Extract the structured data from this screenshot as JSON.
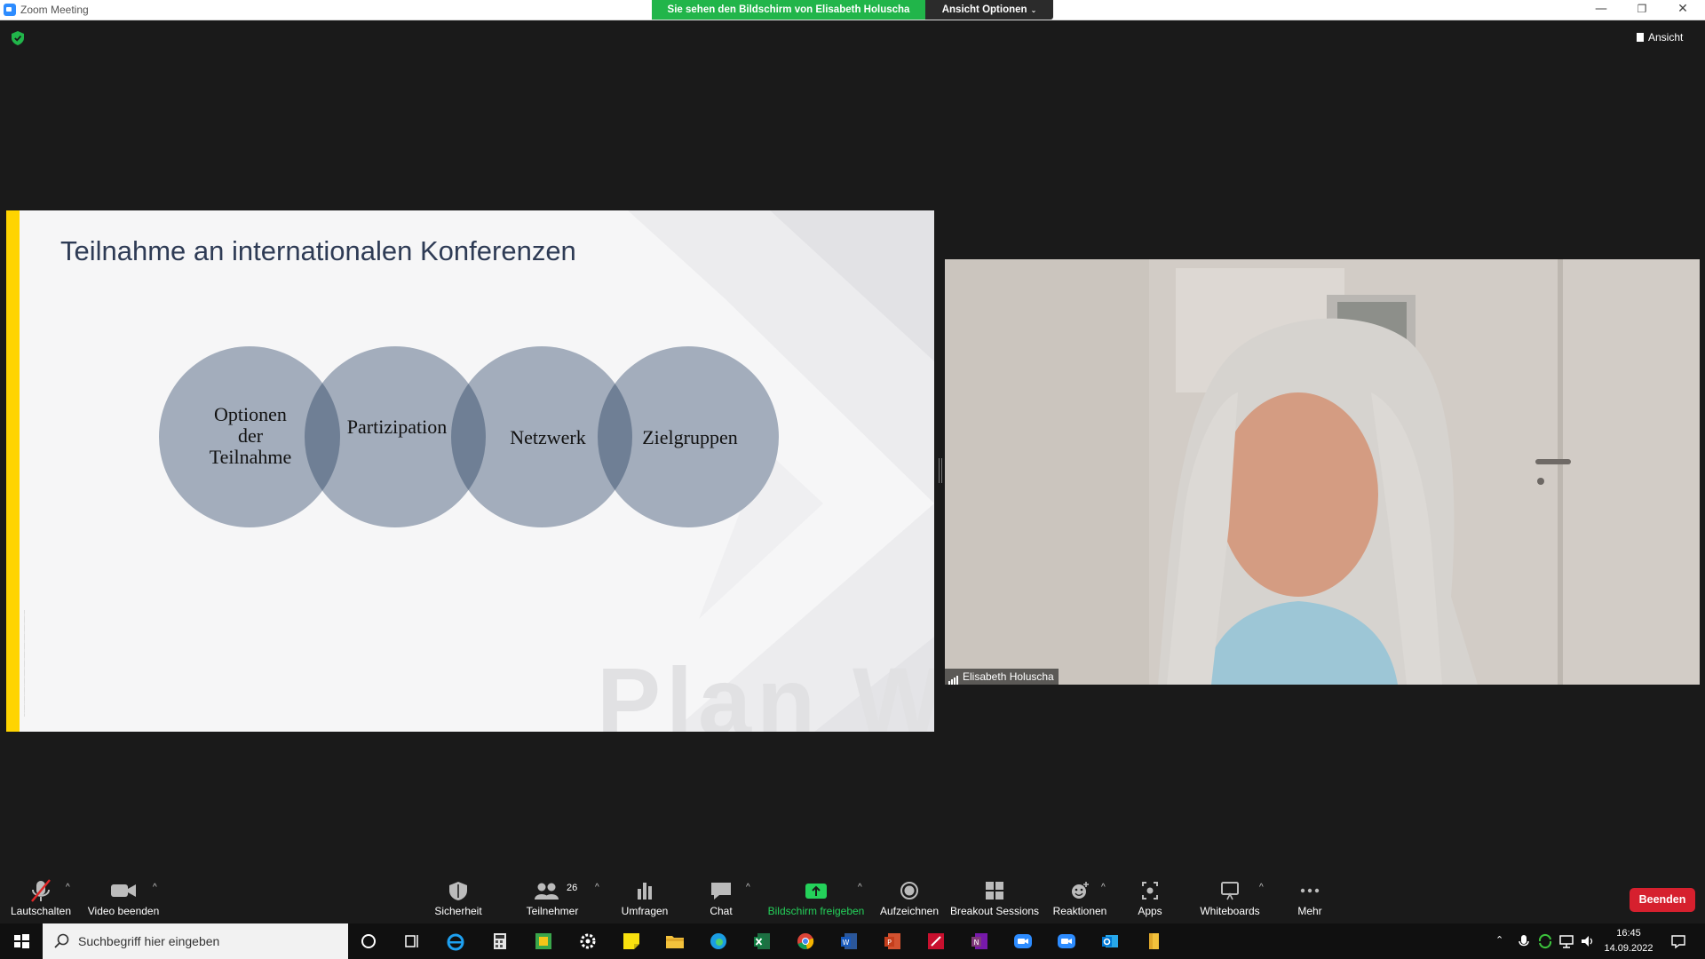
{
  "window": {
    "title": "Zoom Meeting",
    "minimize_glyph": "—",
    "restore_glyph": "❐",
    "close_glyph": "✕"
  },
  "banner": {
    "sharing_text": "Sie sehen den Bildschirm von Elisabeth Holuscha",
    "view_options_label": "Ansicht Optionen",
    "view_options_caret": "⌄"
  },
  "view_button": {
    "label": "Ansicht"
  },
  "slide": {
    "title": "Teilnahme an internationalen Konferenzen",
    "circles": [
      {
        "label": "Optionen der Teilnahme"
      },
      {
        "label": "Partizipation"
      },
      {
        "label": "Netzwerk"
      },
      {
        "label": "Zielgruppen"
      }
    ],
    "watermark": "Plan W",
    "colors": {
      "circle": "#a3adbc",
      "overlap": "#6f7f95",
      "accent_bar": "#ffd400"
    }
  },
  "participant": {
    "name": "Elisabeth Holuscha"
  },
  "toolbar": {
    "mute_label": "Lautschalten",
    "video_label": "Video beenden",
    "security_label": "Sicherheit",
    "participants_label": "Teilnehmer",
    "participants_count": "26",
    "polls_label": "Umfragen",
    "chat_label": "Chat",
    "share_label": "Bildschirm freigeben",
    "record_label": "Aufzeichnen",
    "breakout_label": "Breakout Sessions",
    "reactions_label": "Reaktionen",
    "apps_label": "Apps",
    "whiteboards_label": "Whiteboards",
    "more_label": "Mehr",
    "end_label": "Beenden",
    "caret": "^",
    "colors": {
      "share_green": "#24d15a",
      "end_red": "#d6202e"
    }
  },
  "taskbar": {
    "search_placeholder": "Suchbegriff hier eingeben",
    "time": "16:45",
    "date": "14.09.2022",
    "icons": [
      "windows-start-icon",
      "cortana-icon",
      "task-view-icon",
      "internet-explorer-icon",
      "calculator-icon",
      "photos-icon",
      "settings-icon",
      "sticky-notes-icon",
      "file-explorer-icon",
      "edge-icon",
      "excel-icon",
      "chrome-icon",
      "word-icon",
      "powerpoint-icon",
      "pdf-editor-icon",
      "onenote-icon",
      "zoom-icon",
      "zoom-meeting-icon",
      "outlook-icon",
      "file-icon"
    ]
  }
}
